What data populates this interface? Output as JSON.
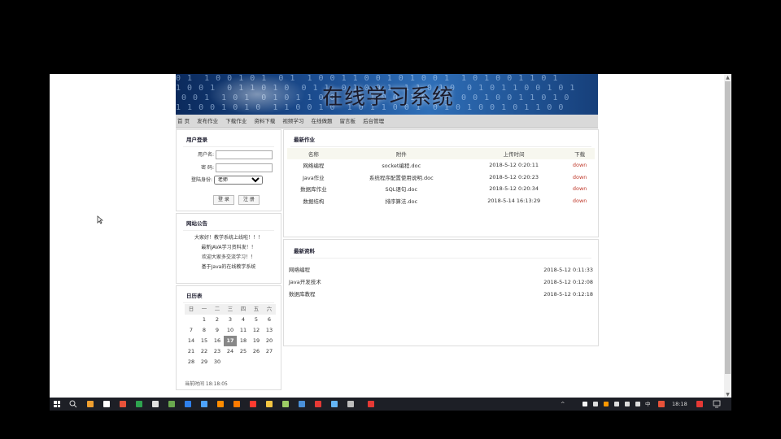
{
  "site": {
    "title": "在线学习系统",
    "nav": [
      "首 页",
      "发布作业",
      "下载作业",
      "资料下载",
      "视频学习",
      "在线做题",
      "留言板",
      "后台管理"
    ]
  },
  "login": {
    "heading": "用户登录",
    "username_label": "用户名:",
    "password_label": "密    码:",
    "role_label": "登陆身份:",
    "role_value": "老师",
    "login_button": "登 录",
    "register_button": "注 册"
  },
  "notice": {
    "heading": "网站公告",
    "items": [
      "大家好！教学系统上线啦！！！",
      "最新JAVA学习资料发！！",
      "欢迎大家多交流学习！！",
      "基于Java的在线教学系统"
    ]
  },
  "calendar": {
    "heading": "日历表",
    "weekdays": [
      "日",
      "一",
      "二",
      "三",
      "四",
      "五",
      "六"
    ],
    "weeks": [
      [
        "",
        "1",
        "2",
        "3",
        "4",
        "5",
        "6"
      ],
      [
        "7",
        "8",
        "9",
        "10",
        "11",
        "12",
        "13"
      ],
      [
        "14",
        "15",
        "16",
        "17",
        "18",
        "19",
        "20"
      ],
      [
        "21",
        "22",
        "23",
        "24",
        "25",
        "26",
        "27"
      ],
      [
        "28",
        "29",
        "30",
        "",
        "",
        "",
        ""
      ]
    ],
    "today": "17",
    "current_time": "当前时间 18:18:05"
  },
  "homework": {
    "heading": "最新作业",
    "columns": [
      "名称",
      "附件",
      "上传时间",
      "下载"
    ],
    "rows": [
      [
        "网络编程",
        "socket编程.doc",
        "2018-5-12 0:20:11",
        "down"
      ],
      [
        "Java作业",
        "系统程序配置使用说明.doc",
        "2018-5-12 0:20:23",
        "down"
      ],
      [
        "数据库作业",
        "SQL语句.doc",
        "2018-5-12 0:20:34",
        "down"
      ],
      [
        "数据结构",
        "排序算法.doc",
        "2018-5-14 16:13:29",
        "down"
      ]
    ]
  },
  "resources": {
    "heading": "最新资料",
    "items": [
      {
        "name": "网络编程",
        "date": "2018-5-12 0:11:33"
      },
      {
        "name": "Java开发技术",
        "date": "2018-5-12 0:12:08"
      },
      {
        "name": "数据库教程",
        "date": "2018-5-12 0:12:18"
      }
    ]
  },
  "taskbar": {
    "clock": "18:18",
    "input_method": "中",
    "icon_colors": [
      "#f0a030",
      "#ffffff",
      "#e8523a",
      "#2ea44f",
      "#e0e0e0",
      "#6aa84f",
      "#2f80ed",
      "#4da3ff",
      "#ff8c00",
      "#ff7b00",
      "#ff3b30",
      "#f4c542",
      "#9ccc65",
      "#4a90d9",
      "#e53935",
      "#64b5f6",
      "#bdbdbd",
      "#e53935"
    ]
  }
}
